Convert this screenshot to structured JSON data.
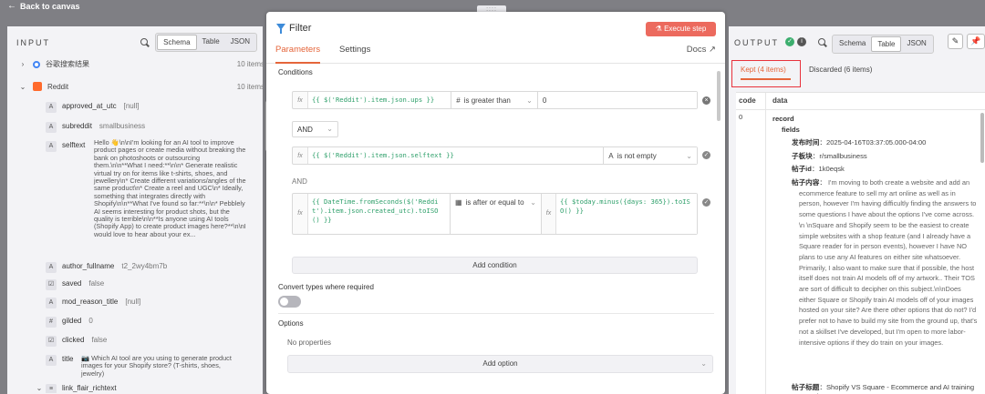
{
  "topbar": {
    "back_label": "Back to canvas",
    "drag_handle": "::::"
  },
  "input": {
    "title": "INPUT",
    "view_tabs": [
      "Schema",
      "Table",
      "JSON"
    ],
    "active_view": "Schema",
    "nodes": [
      {
        "name": "谷歌搜索结果",
        "count": "10 items",
        "expanded": false
      },
      {
        "name": "Reddit",
        "count": "10 items",
        "expanded": true
      }
    ],
    "fields": [
      {
        "type": "A",
        "name": "approved_at_utc",
        "value": "[null]"
      },
      {
        "type": "A",
        "name": "subreddit",
        "value": "smallbusiness"
      },
      {
        "type": "A",
        "name": "selftext",
        "value": "Hello 👋\\n\\nI'm looking for an AI tool to improve product pages or create media without breaking the bank on photoshoots or outsourcing them.\\n\\n**What I need:**\\n\\n* Generate realistic virtual try on for items like t-shirts, shoes, and jewellery\\n* Create different variations/angles of the same product\\n* Create a reel and UGC\\n* Ideally, something that integrates directly with Shopify\\n\\n**What I've found so far:**\\n\\n* Pebblely AI seems interesting for product shots, but the quality is terrible\\n\\n**Is anyone using AI tools (Shopify App) to create product images here?**\\n\\nI would love to hear about your ex..."
      },
      {
        "type": "A",
        "name": "author_fullname",
        "value": "t2_2wy4bm7b"
      },
      {
        "type": "☑",
        "name": "saved",
        "value": "false"
      },
      {
        "type": "A",
        "name": "mod_reason_title",
        "value": "[null]"
      },
      {
        "type": "#",
        "name": "gilded",
        "value": "0"
      },
      {
        "type": "☑",
        "name": "clicked",
        "value": "false"
      },
      {
        "type": "A",
        "name": "title",
        "value": "📷 Which AI tool are you using to generate product images for your Shopify store? (T-shirts, shoes, jewelry)"
      },
      {
        "type": "≡",
        "name": "link_flair_richtext",
        "value": ""
      }
    ]
  },
  "modal": {
    "title": "Filter",
    "execute_label": "Execute step",
    "tabs": [
      "Parameters",
      "Settings"
    ],
    "active_tab": "Parameters",
    "docs_label": "Docs ↗",
    "conditions_label": "Conditions",
    "conditions": [
      {
        "expr_open": "{{ $('Reddit').item.json.ups }}",
        "operator": "is greater than",
        "operator_icon": "#",
        "value": "0"
      },
      {
        "expr_open": "{{ $('Reddit').item.json.selftext }}",
        "operator": "is not empty",
        "operator_icon": "A",
        "value": ""
      },
      {
        "expr_open": "{{ DateTime.fromSeconds($('Reddit').item.json.created_utc).toISO() }}",
        "operator": "is after or equal to",
        "operator_icon": "▦",
        "value": "{{ $today.minus({days: 365}).toISO() }}"
      }
    ],
    "combinator_select": "AND",
    "combinator_text": "AND",
    "add_condition_label": "Add condition",
    "convert_types_label": "Convert types where required",
    "options_label": "Options",
    "no_properties": "No properties",
    "add_option_label": "Add option"
  },
  "output": {
    "title": "OUTPUT",
    "view_tabs": [
      "Schema",
      "Table",
      "JSON"
    ],
    "active_view": "Table",
    "kept_label": "Kept (4 items)",
    "discarded_label": "Discarded (6 items)",
    "col_code": "code",
    "col_data": "data",
    "row_code": "0",
    "record_label": "record",
    "fields_label": "fields",
    "publish_time_key": "发布时间",
    "publish_time_val": "2025-04-16T03:37:05.000-04:00",
    "subsection_key": "子板块",
    "subsection_val": "r/smallbusiness",
    "post_id_key": "帖子id",
    "post_id_val": "1k0eqsk",
    "post_content_key": "帖子内容",
    "post_content_val": "I'm moving to both create a website and add an ecommerce feature to sell my art online as well as in person, however I'm having difficultly finding the answers to some questions I have about the options I've come across. \\n \\nSquare and Shopify seem to be the easiest to create simple websites with a shop feature (and I already have a Square reader for in person events), however I have NO plans to use any AI features on either site whatsoever. Primarily, I also want to make sure that if possible, the host itself does not train AI models off of my artwork.. Their TOS are sort of difficult to decipher on this subject.\\n\\nDoes either Square or Shopify train AI models off of your images hosted on your site? Are there other options that do not? I'd prefer not to have to build my site from the ground up, that's not a skillset I've developed, but I'm open to more labor-intensive options if they do train on your images.",
    "post_title_key": "帖子标题",
    "post_title_val": "Shopify VS Square - Ecommerce and AI training on your images?"
  },
  "colors": {
    "accent": "#e5653a",
    "execute": "#ec6a5e",
    "success": "#3cae6e",
    "info": "#555555",
    "highlight_border": "#e8323c",
    "expr_green": "#2fa06b"
  }
}
